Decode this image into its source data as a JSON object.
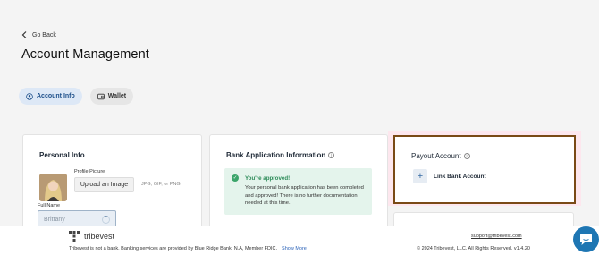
{
  "nav": {
    "go_back": "Go Back"
  },
  "page": {
    "title": "Account Management"
  },
  "tabs": [
    {
      "label": "Account Info",
      "active": true,
      "icon": "user-circle-icon"
    },
    {
      "label": "Wallet",
      "active": false,
      "icon": "wallet-icon"
    }
  ],
  "personal_info": {
    "title": "Personal Info",
    "profile_picture_label": "Profile Picture",
    "upload_button": "Upload an Image",
    "formats": "JPG, GIF, or PNG",
    "full_name_label": "Full Name",
    "full_name_value": "Brittany"
  },
  "bank_application": {
    "title": "Bank Application Information",
    "approved_title": "You're approved!",
    "approved_message": "Your personal bank application has been completed and approved! There is no further documentation needed at this time."
  },
  "payout_account": {
    "title": "Payout Account",
    "link_label": "Link Bank Account"
  },
  "footer": {
    "brand": "tribevest",
    "disclaimer": "Tribevest is not a bank. Banking services are provided by Blue Ridge Bank, N.A, Member FDIC.",
    "show_more": "Show More",
    "support_email": "support@tribevest.com",
    "copyright": "© 2024 Tribevest, LLC. All Rights Reserved. v1.4.20"
  },
  "colors": {
    "accent": "#1d4f8a",
    "approved_green": "#2a8a57",
    "highlight_border": "#7a4a16",
    "chat_button": "#1e76b3"
  }
}
